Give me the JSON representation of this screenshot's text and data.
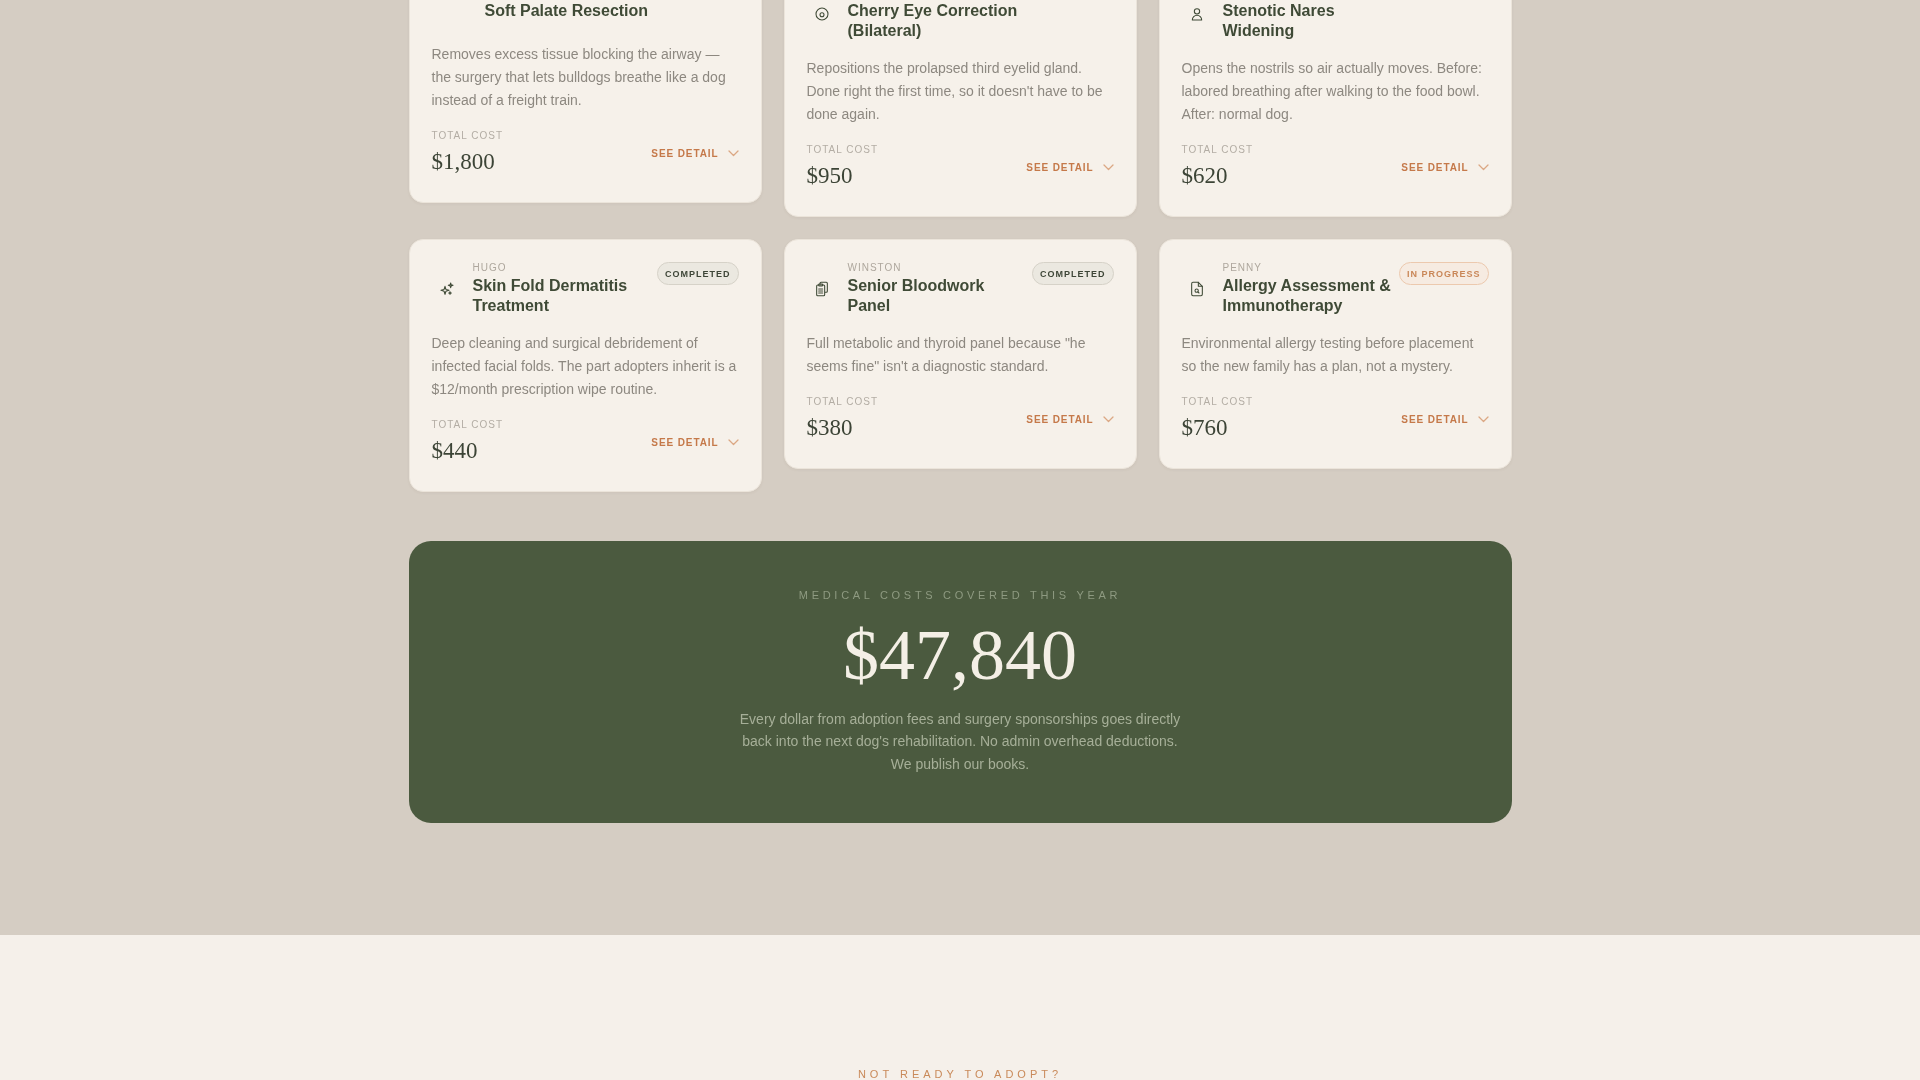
{
  "procedures": [
    {
      "title": "Soft Palate Resection",
      "description": "Removes excess tissue blocking the airway — the surgery that lets bulldogs breathe like a dog instead of a freight train.",
      "cost_label": "TOTAL COST",
      "cost": "$1,800",
      "action": "SEE DETAIL",
      "expanded": false
    },
    {
      "title": "Cherry Eye Correction (Bilateral)",
      "description": "Repositions the prolapsed third eyelid gland. Done right the first time, so it doesn't have to be done again.",
      "cost_label": "TOTAL COST",
      "cost": "$950",
      "action": "SEE DETAIL",
      "expanded": false
    },
    {
      "title": "Stenotic Nares Widening",
      "description": "Opens the nostrils so air actually moves. Before: labored breathing after walking to the food bowl. After: normal dog.",
      "cost_label": "TOTAL COST",
      "cost": "$620",
      "action": "SEE DETAIL",
      "expanded": false
    },
    {
      "pet": "HUGO",
      "title": "Skin Fold Dermatitis Treatment",
      "status": {
        "label": "COMPLETED",
        "kind": "completed"
      },
      "description": "Deep cleaning and surgical debridement of infected facial folds. The part adopters inherit is a $12/month prescription wipe routine.",
      "cost_label": "TOTAL COST",
      "cost": "$440",
      "action": "SEE DETAIL",
      "expanded": false
    },
    {
      "pet": "WINSTON",
      "title": "Senior Bloodwork Panel",
      "status": {
        "label": "COMPLETED",
        "kind": "completed"
      },
      "description": "Full metabolic and thyroid panel because \"he seems fine\" isn't a diagnostic standard.",
      "cost_label": "TOTAL COST",
      "cost": "$380",
      "action": "SEE DETAIL",
      "expanded": false
    },
    {
      "pet": "PENNY",
      "title": "Allergy Assessment & Immunotherapy",
      "status": {
        "label": "IN PROGRESS",
        "kind": "in_progress"
      },
      "description": "Environmental allergy testing before placement so the new family has a plan, not a mystery.",
      "cost_label": "TOTAL COST",
      "cost": "$760",
      "action": "SEE DETAIL",
      "expanded": false
    }
  ],
  "summary": {
    "label": "MEDICAL COSTS COVERED THIS YEAR",
    "total": "$47,840",
    "text": "Every dollar from adoption fees and surgery sponsorships goes directly back into the next dog's rehabilitation. No admin overhead deductions. We publish our books."
  },
  "next_section": {
    "eyebrow": "NOT READY TO ADOPT?"
  }
}
